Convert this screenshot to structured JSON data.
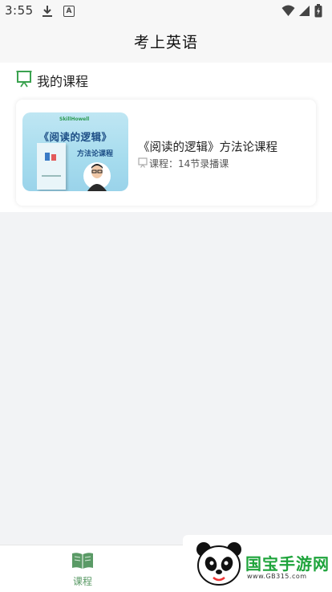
{
  "status_bar": {
    "time": "3:55",
    "icons": [
      "download-icon",
      "a-notification-icon",
      "wifi-icon",
      "signal-icon",
      "battery-icon"
    ]
  },
  "header": {
    "title": "考上英语"
  },
  "courses_section": {
    "title": "我的课程",
    "icon": "chalkboard-icon",
    "accent": "#3aa24f",
    "items": [
      {
        "name": "《阅读的逻辑》方法论课程",
        "meta": "课程：14节录播课",
        "meta_icon": "chalkboard-icon",
        "cover": {
          "brand": "SkillHowell",
          "heading": "《阅读的逻辑》",
          "subheading": "方法论课程"
        }
      }
    ]
  },
  "tabbar": {
    "tabs": [
      {
        "label": "课程",
        "icon": "book-icon",
        "active": true,
        "color": "#5a9a66"
      }
    ]
  },
  "watermark": {
    "text": "国宝手游网",
    "url": "www.GB315.com",
    "icon": "panda-logo"
  }
}
